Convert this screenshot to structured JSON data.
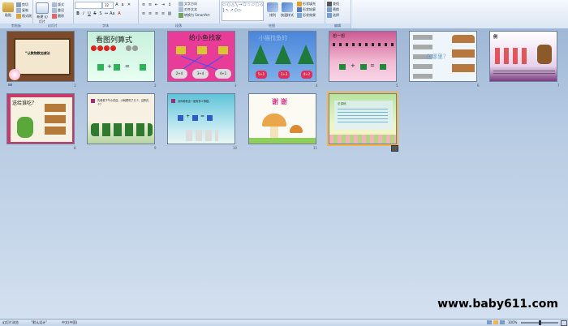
{
  "ribbon": {
    "groups": [
      {
        "label": "剪贴板"
      },
      {
        "label": "幻灯片"
      },
      {
        "label": "字体"
      },
      {
        "label": "段落"
      },
      {
        "label": "绘图"
      },
      {
        "label": "编辑"
      }
    ],
    "paste_label": "粘贴",
    "new_slide_label": "新建\n幻灯片",
    "cut_label": "剪切",
    "copy_label": "复制",
    "format_painter_label": "格式刷",
    "layout_label": "版式",
    "reset_label": "重设",
    "delete_label": "删除",
    "font_size": "32",
    "text_direction_label": "文字方向",
    "align_text_label": "对齐文本",
    "smartart_label": "转换为 SmartArt",
    "arrange_label": "排列",
    "quick_styles_label": "快速样式",
    "shape_fill_label": "形状填充",
    "shape_outline_label": "形状轮廓",
    "shape_effects_label": "形状效果",
    "find_label": "查找",
    "replace_label": "替换",
    "select_label": "选择"
  },
  "slides": [
    {
      "num": "1",
      "title": "“认数物数加减法"
    },
    {
      "num": "2",
      "title": "看图列算式",
      "eq": [
        "+",
        "="
      ]
    },
    {
      "num": "3",
      "title": "给小鱼找家",
      "bubbles": [
        "2+4",
        "3+4",
        "4+1"
      ]
    },
    {
      "num": "4",
      "title": "小猫找鱼的",
      "hearts": [
        "5+1",
        "2+3",
        "4+2"
      ]
    },
    {
      "num": "5",
      "title": "想一想",
      "eq": [
        "+",
        "="
      ]
    },
    {
      "num": "6",
      "title": "在哪里？"
    },
    {
      "num": "7",
      "title": "例"
    },
    {
      "num": "8",
      "title": "送给谁吃？"
    },
    {
      "num": "9",
      "title": "先看看下午小花店，小刺猬吃了几个，还剩几个？"
    },
    {
      "num": "10",
      "title": "请你看看这一组有多少算题。",
      "eq": [
        "+",
        "="
      ]
    },
    {
      "num": "11",
      "title": "谢 谢"
    },
    {
      "num": "12",
      "title": "说课稿"
    }
  ],
  "status": {
    "slide_view": "幻灯片浏览",
    "theme": "“默认设计”",
    "language": "中文(中国)",
    "zoom": "100%"
  },
  "watermark": "www.baby611.com"
}
